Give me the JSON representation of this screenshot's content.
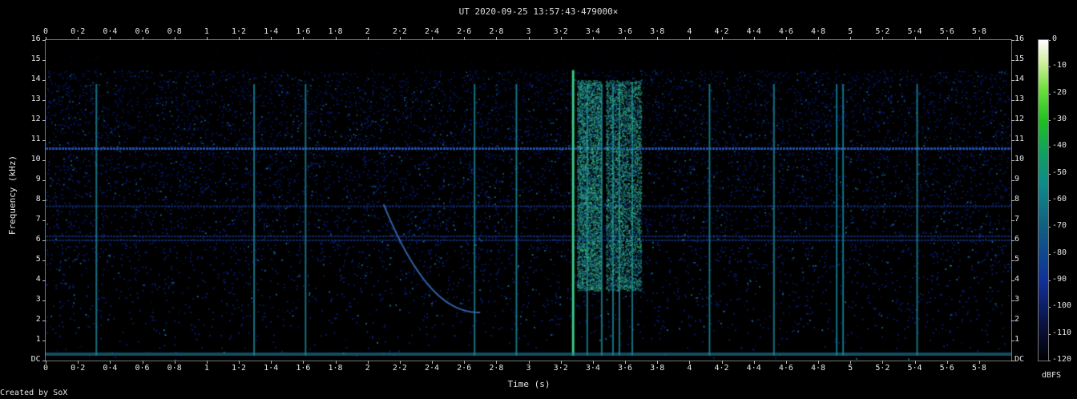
{
  "chart_data": {
    "type": "heatmap",
    "title": "UT 2020-09-25 13:57:43·479000×",
    "xlabel": "Time (s)",
    "ylabel": "Frequency (kHz)",
    "xlim": [
      0,
      6.0
    ],
    "ylim": [
      0,
      16
    ],
    "x_ticks": [
      "0",
      "0·2",
      "0·4",
      "0·6",
      "0·8",
      "1",
      "1·2",
      "1·4",
      "1·6",
      "1·8",
      "2",
      "2·2",
      "2·4",
      "2·6",
      "2·8",
      "3",
      "3·2",
      "3·4",
      "3·6",
      "3·8",
      "4",
      "4·2",
      "4·4",
      "4·6",
      "4·8",
      "5",
      "5·2",
      "5·4",
      "5·6",
      "5·8"
    ],
    "y_ticks": [
      "DC",
      "1",
      "2",
      "3",
      "4",
      "5",
      "6",
      "7",
      "8",
      "9",
      "10",
      "11",
      "12",
      "13",
      "14",
      "15",
      "16"
    ],
    "colorbar": {
      "unit": "dBFS",
      "range": [
        -120,
        0
      ],
      "ticks": [
        "0",
        "-10",
        "-20",
        "-30",
        "-40",
        "-50",
        "-60",
        "-70",
        "-80",
        "-90",
        "-100",
        "-110",
        "-120"
      ]
    },
    "features": {
      "horizontal_lines_khz": [
        10.6,
        7.7,
        6.2,
        6.0
      ],
      "vertical_impulses_s": [
        0.31,
        1.29,
        1.61,
        2.66,
        2.92,
        3.27,
        3.36,
        3.45,
        3.52,
        3.56,
        3.64,
        4.12,
        4.52,
        4.91,
        4.95,
        5.41
      ],
      "strongest_impulse_s": 3.27,
      "broadband_bursts_s": [
        [
          3.3,
          3.45
        ],
        [
          3.48,
          3.7
        ]
      ],
      "falling_tone": {
        "start_s": 2.1,
        "start_khz": 7.8,
        "end_s": 2.7,
        "end_khz": 2.4
      }
    },
    "colors": {
      "background": "#000000",
      "noise_floor": "#0a1a60",
      "low": "#10309a",
      "mid": "#1a8a9a",
      "high": "#40d040",
      "max": "#ffffff"
    }
  },
  "footer": {
    "credit": "Created by SoX"
  }
}
